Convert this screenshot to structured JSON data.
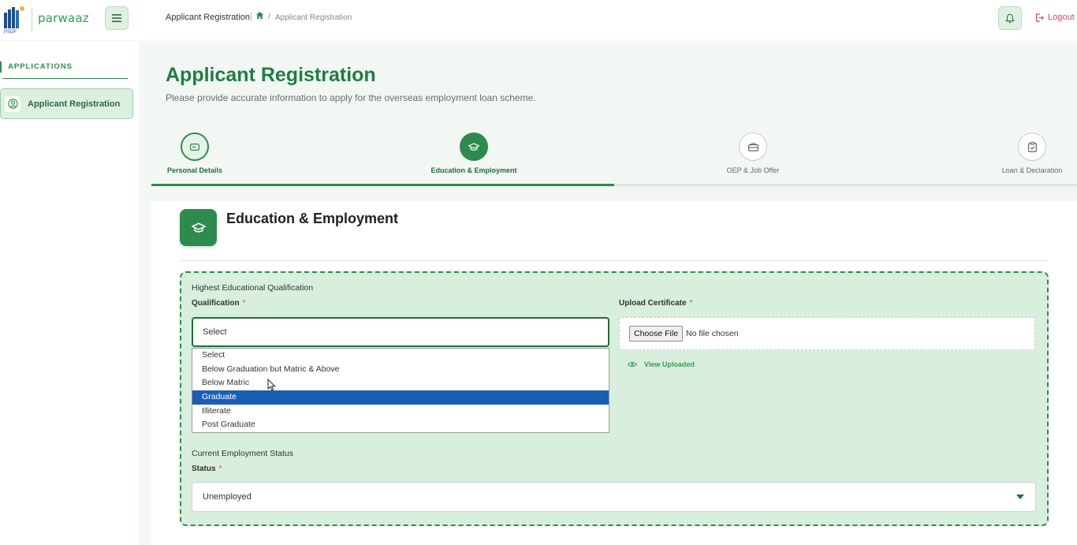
{
  "header": {
    "logo_text": "PSDF",
    "brand": "parwaaz",
    "breadcrumb_title": "Applicant Registration",
    "breadcrumb_current": "Applicant Registration",
    "logout_label": "Logout"
  },
  "sidebar": {
    "heading": "APPLICATIONS",
    "items": [
      {
        "label": "Applicant Registration",
        "icon": "user-circle-icon",
        "active": true
      }
    ]
  },
  "page": {
    "title": "Applicant Registration",
    "subtitle": "Please provide accurate information to apply for the overseas employment loan scheme."
  },
  "stepper": {
    "steps": [
      {
        "label": "Personal Details",
        "icon": "id-card-icon",
        "state": "done"
      },
      {
        "label": "Education & Employment",
        "icon": "graduation-cap-icon",
        "state": "active"
      },
      {
        "label": "OEP & Job Offer",
        "icon": "briefcase-icon",
        "state": "todo"
      },
      {
        "label": "Loan & Declaration",
        "icon": "clipboard-icon",
        "state": "todo"
      }
    ],
    "progress": 0.5
  },
  "section": {
    "title": "Education & Employment",
    "education_group": "Highest Educational Qualification",
    "qualification_label": "Qualification",
    "qualification_value": "Select",
    "qualification_options": [
      "Select",
      "Below Graduation but Matric & Above",
      "Below Matric",
      "Graduate",
      "Illiterate",
      "Post Graduate"
    ],
    "highlighted_option": "Graduate",
    "upload_label": "Upload Certificate",
    "file_button": "Choose File",
    "file_status": "No file chosen",
    "view_uploaded": "View Uploaded",
    "employment_group": "Current Employment Status",
    "status_label": "Status",
    "status_value": "Unemployed",
    "required_mark": "*"
  },
  "colors": {
    "accent": "#2e8b4e",
    "title_green": "#1e7d45",
    "logout_red": "#e0455e",
    "highlight_blue": "#1a5fb4",
    "panel_bg": "#d8efdd"
  }
}
